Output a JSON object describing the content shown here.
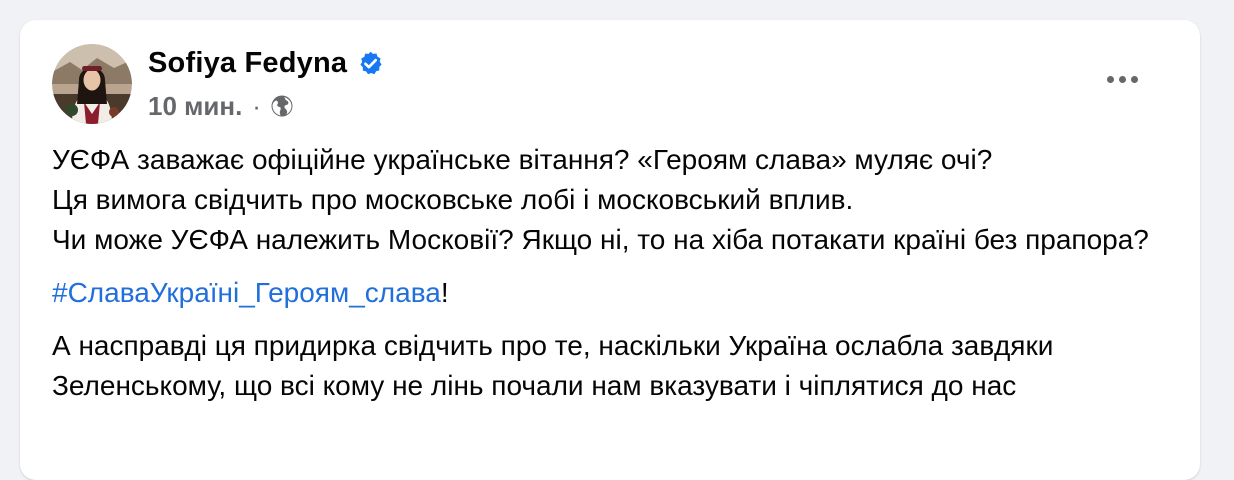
{
  "post": {
    "author": "Sofiya Fedyna",
    "verified_icon": "verified-badge-icon",
    "timestamp": "10 мин.",
    "separator": "·",
    "audience_icon": "globe-icon",
    "more_icon": "more-options-icon",
    "paragraph1": [
      "УЄФА заважає офіційне українське вітання? «Героям слава» муляє очі?",
      "Ця вимога свідчить про московське лобі і московський вплив.",
      "Чи може УЄФА належить Московії? Якщо ні, то на хіба потакати країні без прапора?"
    ],
    "hashtag": "#СлаваУкраїні_Героям_слава",
    "hashtag_suffix": "!",
    "paragraph3": "А насправді ця придирка свідчить про те, наскільки Україна ослабла завдяки Зеленському, що всі кому не лінь почали нам вказувати і чіплятися до нас"
  },
  "colors": {
    "background": "#f0f2f5",
    "card": "#ffffff",
    "text": "#050505",
    "secondary": "#65676b",
    "link": "#216fdb",
    "verified": "#1877f2"
  }
}
